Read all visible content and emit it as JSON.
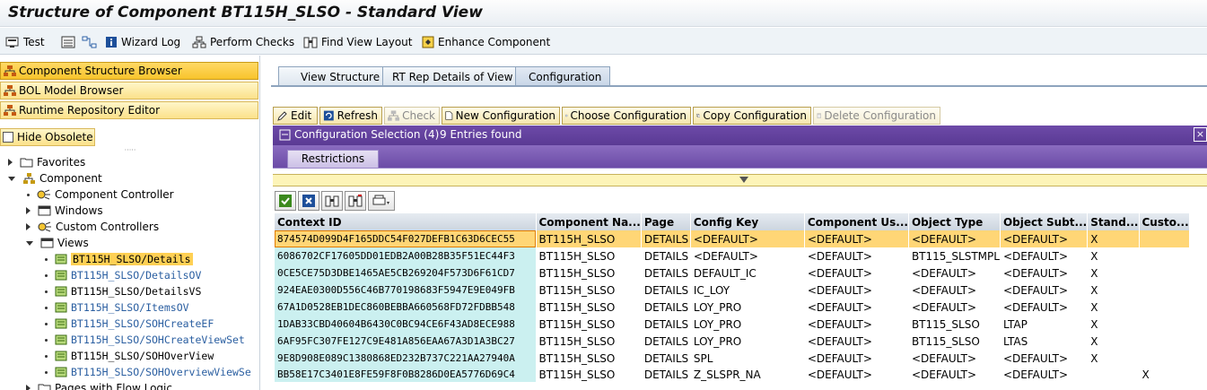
{
  "window": {
    "title": "Structure of Component BT115H_SLSO - Standard View"
  },
  "toolbar": {
    "test_label": "Test",
    "wizard_log_label": "Wizard Log",
    "perform_checks_label": "Perform Checks",
    "find_view_layout_label": "Find View Layout",
    "enhance_component_label": "Enhance Component"
  },
  "nav": {
    "buttons": [
      "Component Structure Browser",
      "BOL Model Browser",
      "Runtime Repository Editor"
    ],
    "hide_obsolete_label": "Hide Obsolete",
    "tree": {
      "favorites": "Favorites",
      "component": "Component",
      "component_controller": "Component Controller",
      "windows": "Windows",
      "custom_controllers": "Custom Controllers",
      "views": "Views",
      "view_items": [
        "BT115H_SLSO/Details",
        "BT115H_SLSO/DetailsOV",
        "BT115H_SLSO/DetailsVS",
        "BT115H_SLSO/ItemsOV",
        "BT115H_SLSO/SOHCreateEF",
        "BT115H_SLSO/SOHCreateViewSet",
        "BT115H_SLSO/SOHOverView",
        "BT115H_SLSO/SOHOverviewViewSe"
      ],
      "pages_with_flow_logic": "Pages with Flow Logic"
    }
  },
  "tabs": [
    "View Structure",
    "RT Rep Details of View",
    "Configuration"
  ],
  "config_toolbar": {
    "edit": "Edit",
    "refresh": "Refresh",
    "check": "Check",
    "new_configuration": "New Configuration",
    "choose_configuration": "Choose Configuration",
    "copy_configuration": "Copy Configuration",
    "delete_configuration": "Delete Configuration"
  },
  "config_selection": {
    "title": "Configuration Selection (4)",
    "entries_found": "9 Entries found",
    "close_symbol": "×",
    "restrictions_tab": "Restrictions"
  },
  "table": {
    "columns": [
      "Context ID",
      "Component Na...",
      "Page",
      "Config Key",
      "Component Us...",
      "Object Type",
      "Object Subt...",
      "Stand...",
      "Custo..."
    ],
    "rows": [
      [
        "874574D099D4F165DDC54F027DEFB1C63D6CEC55",
        "BT115H_SLSO",
        "DETAILS",
        "<DEFAULT>",
        "<DEFAULT>",
        "<DEFAULT>",
        "<DEFAULT>",
        "X",
        ""
      ],
      [
        "6086702CF17605DD01EDB2A00B28B35F51EC44F3",
        "BT115H_SLSO",
        "DETAILS",
        "<DEFAULT>",
        "<DEFAULT>",
        "BT115_SLSTMPL",
        "<DEFAULT>",
        "X",
        ""
      ],
      [
        "0CE5CE75D3DBE1465AE5CB269204F573D6F61CD7",
        "BT115H_SLSO",
        "DETAILS",
        "DEFAULT_IC",
        "<DEFAULT>",
        "<DEFAULT>",
        "<DEFAULT>",
        "X",
        ""
      ],
      [
        "924EAE0300D556C46B770198683F5947E9E049FB",
        "BT115H_SLSO",
        "DETAILS",
        "IC_LOY",
        "<DEFAULT>",
        "<DEFAULT>",
        "<DEFAULT>",
        "X",
        ""
      ],
      [
        "67A1D0528EB1DEC860BEBBA660568FD72FDBB548",
        "BT115H_SLSO",
        "DETAILS",
        "LOY_PRO",
        "<DEFAULT>",
        "<DEFAULT>",
        "<DEFAULT>",
        "X",
        ""
      ],
      [
        "1DAB33CBD40604B6430C0BC94CE6F43AD8ECE988",
        "BT115H_SLSO",
        "DETAILS",
        "LOY_PRO",
        "<DEFAULT>",
        "BT115_SLSO",
        "LTAP",
        "X",
        ""
      ],
      [
        "6AF95FC307FE127C9E481A856EAA67A3D1A3BC27",
        "BT115H_SLSO",
        "DETAILS",
        "LOY_PRO",
        "<DEFAULT>",
        "BT115_SLSO",
        "LTAS",
        "X",
        ""
      ],
      [
        "9E8D908E089C1380868ED232B737C221AA27940A",
        "BT115H_SLSO",
        "DETAILS",
        "SPL",
        "<DEFAULT>",
        "<DEFAULT>",
        "<DEFAULT>",
        "X",
        ""
      ],
      [
        "BB58E17C3401E8FE59F8F0B8286D0EA5776D69C4",
        "BT115H_SLSO",
        "DETAILS",
        "Z_SLSPR_NA",
        "<DEFAULT>",
        "<DEFAULT>",
        "<DEFAULT>",
        "",
        "X"
      ]
    ]
  },
  "colors": {
    "header_purple": "#5a3a94",
    "selected_row": "#ffd676",
    "key_column": "#cbf0f0",
    "nav_button": "#fbe18a"
  }
}
